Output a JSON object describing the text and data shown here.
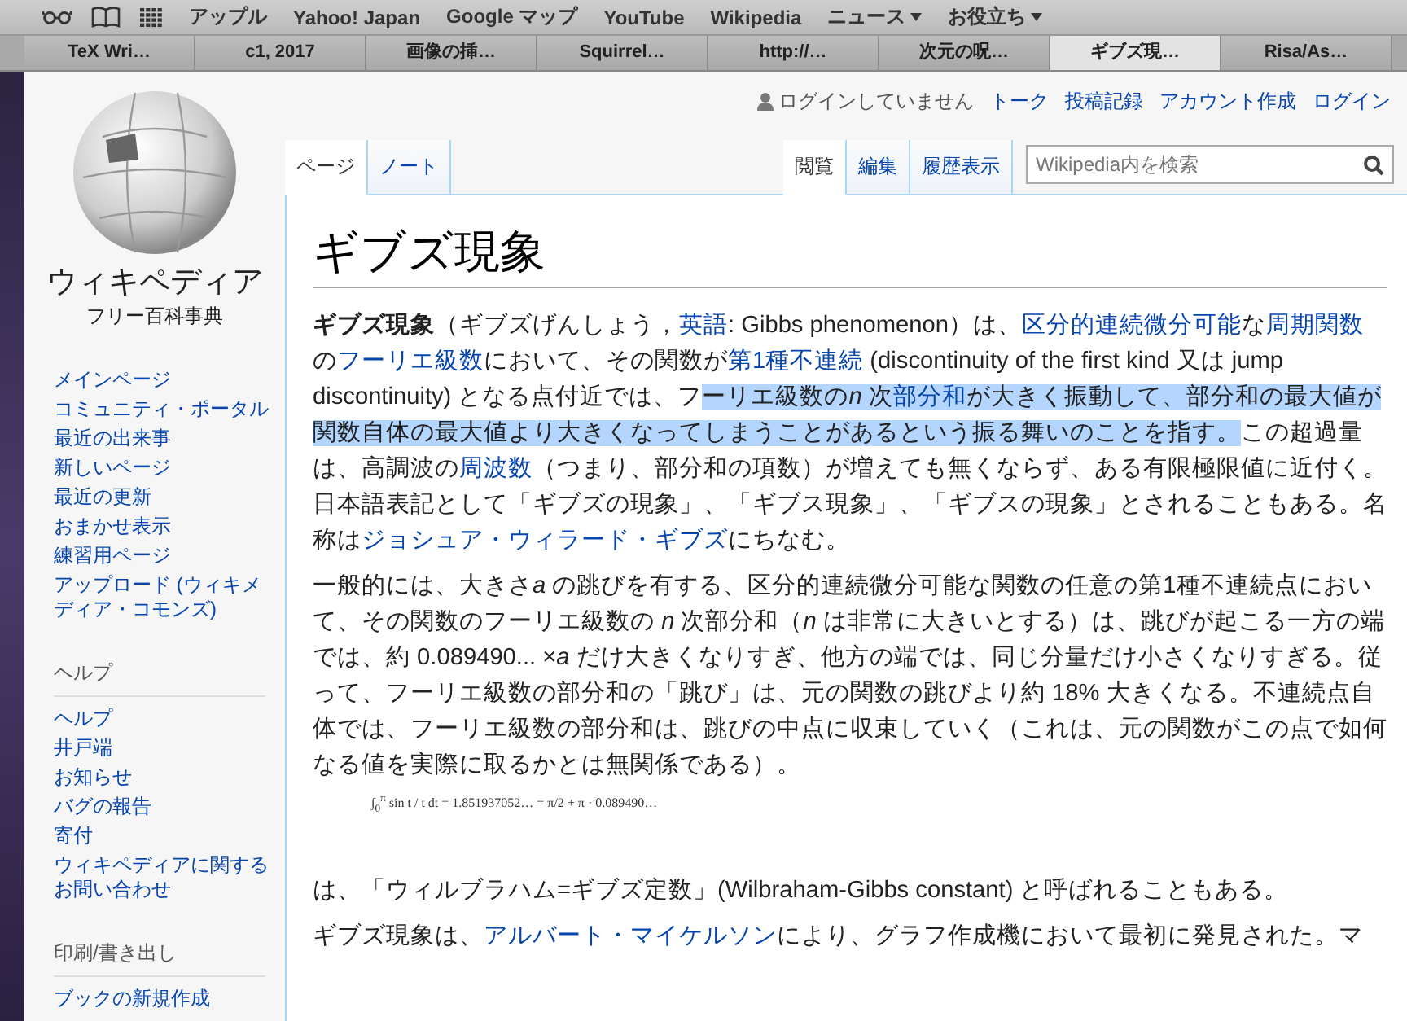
{
  "bookmarks_bar": {
    "items": [
      {
        "label": "アップル",
        "kind": "link"
      },
      {
        "label": "Yahoo! Japan",
        "kind": "link"
      },
      {
        "label": "Google マップ",
        "kind": "link"
      },
      {
        "label": "YouTube",
        "kind": "link"
      },
      {
        "label": "Wikipedia",
        "kind": "link"
      },
      {
        "label": "ニュース",
        "kind": "menu"
      },
      {
        "label": "お役立ち",
        "kind": "menu"
      }
    ]
  },
  "browser_tabs": [
    {
      "label": "TeX Wri…",
      "selected": false
    },
    {
      "label": "c1, 2017",
      "selected": false
    },
    {
      "label": "画像の挿…",
      "selected": false
    },
    {
      "label": "Squirrel…",
      "selected": false
    },
    {
      "label": "http://…",
      "selected": false
    },
    {
      "label": "次元の呪…",
      "selected": false
    },
    {
      "label": "ギブズ現…",
      "selected": true
    },
    {
      "label": "Risa/As…",
      "selected": false
    }
  ],
  "sidebar": {
    "logo": {
      "title": "ウィキペディア",
      "tagline": "フリー百科事典"
    },
    "sections": [
      {
        "items": [
          "メインページ",
          "コミュニティ・ポータル",
          "最近の出来事",
          "新しいページ",
          "最近の更新",
          "おまかせ表示",
          "練習用ページ",
          "アップロード (ウィキメディア・コモンズ)"
        ]
      },
      {
        "heading": "ヘルプ",
        "items": [
          "ヘルプ",
          "井戸端",
          "お知らせ",
          "バグの報告",
          "寄付",
          "ウィキペディアに関するお問い合わせ"
        ]
      },
      {
        "heading": "印刷/書き出し",
        "items": [
          "ブックの新規作成"
        ]
      }
    ]
  },
  "personal_bar": {
    "status": "ログインしていません",
    "links": [
      "トーク",
      "投稿記録",
      "アカウント作成",
      "ログイン"
    ]
  },
  "page_tabs": [
    {
      "label": "ページ",
      "selected": true
    },
    {
      "label": "ノート",
      "selected": false
    }
  ],
  "view_tabs": [
    {
      "label": "閲覧",
      "selected": true
    },
    {
      "label": "編集",
      "selected": false
    },
    {
      "label": "履歴表示",
      "selected": false
    }
  ],
  "search": {
    "placeholder": "Wikipedia内を検索"
  },
  "article": {
    "title": "ギブズ現象",
    "blocks": [
      {
        "kind": "paragraph",
        "segments": [
          {
            "kind": "bold",
            "text": "ギブズ現象",
            "highlighted": false
          },
          {
            "kind": "text",
            "text": "（ギブズげんしょう，",
            "highlighted": false
          },
          {
            "kind": "link",
            "text": "英語",
            "highlighted": false
          },
          {
            "kind": "text",
            "text": ": Gibbs phenomenon）は、",
            "highlighted": false
          },
          {
            "kind": "link",
            "text": "区分的連続微分可能",
            "highlighted": false
          },
          {
            "kind": "text",
            "text": "な",
            "highlighted": false
          },
          {
            "kind": "link",
            "text": "周期関数",
            "highlighted": false
          },
          {
            "kind": "text",
            "text": "の",
            "highlighted": false
          },
          {
            "kind": "link",
            "text": "フーリエ級数",
            "highlighted": false
          },
          {
            "kind": "text",
            "text": "において、その関数が",
            "highlighted": false
          },
          {
            "kind": "link",
            "text": "第1種不連続",
            "highlighted": false
          },
          {
            "kind": "text",
            "text": " (discontinuity of the first kind 又は jump discontinuity) となる点付近では、フ",
            "highlighted": false
          },
          {
            "kind": "text",
            "text": "ーリエ級数の",
            "highlighted": true
          },
          {
            "kind": "italic",
            "text": "n",
            "highlighted": true
          },
          {
            "kind": "text",
            "text": " 次",
            "highlighted": true
          },
          {
            "kind": "link",
            "text": "部分和",
            "highlighted": true
          },
          {
            "kind": "text",
            "text": "が大きく振動して、部分和の最大値が関数自体の最大値より大きくなってしまうことがあるという振る舞いのことを指す。",
            "highlighted": true
          },
          {
            "kind": "text",
            "text": "この超過量は、高調波の",
            "highlighted": false
          },
          {
            "kind": "link",
            "text": "周波数",
            "highlighted": false
          },
          {
            "kind": "text",
            "text": "（つまり、部分和の項数）が増えても無くならず、ある有限極限値に近付く。日本語表記として「ギブズの現象」、「ギブス現象」、「ギブスの現象」とされることもある。名称は",
            "highlighted": false
          },
          {
            "kind": "link",
            "text": "ジョシュア・ウィラード・ギブズ",
            "highlighted": false
          },
          {
            "kind": "text",
            "text": "にちなむ。",
            "highlighted": false
          }
        ]
      },
      {
        "kind": "paragraph",
        "segments": [
          {
            "kind": "text",
            "text": "一般的には、大きさ",
            "highlighted": false
          },
          {
            "kind": "italic",
            "text": "a",
            "highlighted": false
          },
          {
            "kind": "text",
            "text": " の跳びを有する、区分的連続微分可能な関数の任意の第1種不連続点において、その関数のフーリエ級数の ",
            "highlighted": false
          },
          {
            "kind": "italic",
            "text": "n",
            "highlighted": false
          },
          {
            "kind": "text",
            "text": " 次部分和（",
            "highlighted": false
          },
          {
            "kind": "italic",
            "text": "n",
            "highlighted": false
          },
          {
            "kind": "text",
            "text": " は非常に大きいとする）は、跳びが起こる一方の端では、約 0.089490... ×",
            "highlighted": false
          },
          {
            "kind": "italic",
            "text": "a",
            "highlighted": false
          },
          {
            "kind": "text",
            "text": " だけ大きくなりすぎ、他方の端では、同じ分量だけ小さくなりすぎる。従って、フーリエ級数の部分和の「跳び」は、元の関数の跳びより約 18% 大きくなる。不連続点自体では、フーリエ級数の部分和は、跳びの中点に収束していく（これは、元の関数がこの点で如何なる値を実際に取るかとは無関係である）。",
            "highlighted": false
          }
        ]
      },
      {
        "kind": "formula",
        "text": "∫$_{0}$$^{π}$ sin t / t dt = 1.851937052… = π/2 + π · 0.089490…"
      },
      {
        "kind": "paragraph",
        "segments": [
          {
            "kind": "text",
            "text": "は、「ウィルブラハム=ギブズ定数」(Wilbraham-Gibbs constant) と呼ばれることもある。",
            "highlighted": false
          }
        ]
      },
      {
        "kind": "paragraph",
        "segments": [
          {
            "kind": "text",
            "text": "ギブズ現象は、",
            "highlighted": false
          },
          {
            "kind": "link",
            "text": "アルバート・マイケルソン",
            "highlighted": false
          },
          {
            "kind": "text",
            "text": "により、グラフ作成機において最初に発見された。マ",
            "highlighted": false
          }
        ]
      }
    ]
  }
}
